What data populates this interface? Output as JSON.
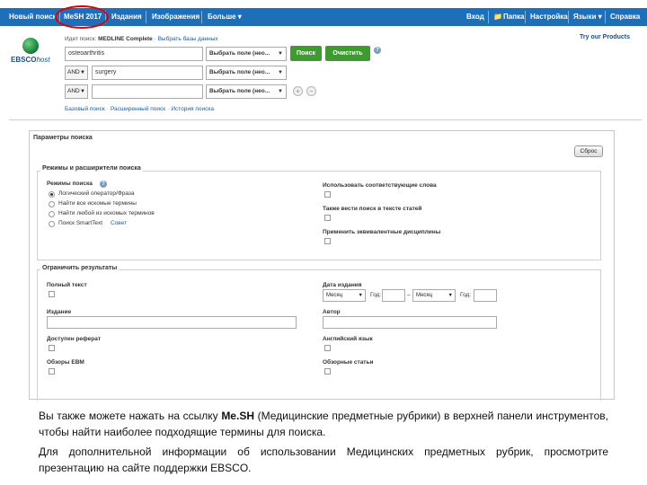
{
  "nav": {
    "left": [
      "Новый поиск",
      "MeSH 2017",
      "Издания",
      "Изображения",
      "Больше ▾"
    ],
    "right": [
      "Вход",
      "Папка",
      "Настройка",
      "Языки ▾",
      "Справка"
    ]
  },
  "try_products": "Try our Products",
  "logo": {
    "brand": "EBSCO",
    "suffix": "host"
  },
  "db_line": {
    "prefix": "Идет поиск:",
    "db": "MEDLINE Complete",
    "choose": "Выбрать базы данных"
  },
  "rows": [
    {
      "bool": "",
      "term": "osteoarthritis",
      "field": "Выбрать поле (нео..."
    },
    {
      "bool": "AND",
      "term": "surgery",
      "field": "Выбрать поле (нео..."
    },
    {
      "bool": "AND",
      "term": "",
      "field": "Выбрать поле (нео..."
    }
  ],
  "buttons": {
    "search": "Поиск",
    "clear": "Очистить",
    "help": "?",
    "add": "+",
    "remove": "−"
  },
  "links": [
    "Базовый поиск",
    "Расширенный поиск",
    "История поиска"
  ],
  "options_panel": {
    "title": "Параметры поиска",
    "close": "Сброс",
    "modes_section": {
      "title": "Режимы и расширители поиска",
      "modes_label": "Режимы поиска",
      "modes": [
        "Логический оператор/Фраза",
        "Найти все искомые термины",
        "Найти любой из искомых терминов",
        "Поиск SmartText"
      ],
      "hint_link": "Совет",
      "right": [
        "Использовать соответствующие слова",
        "Также вести поиск в тексте статей",
        "Применить эквивалентные дисциплины"
      ]
    },
    "limits_section": {
      "title": "Ограничить результаты",
      "full_text": "Полный текст",
      "publication": "Издание",
      "abstract": "Доступен реферат",
      "ebm": "Обзоры EBM",
      "pub_date": "Дата издания",
      "month": "Месяц",
      "year": "Год:",
      "dash": "–",
      "author": "Автор",
      "english": "Английский язык",
      "review": "Обзорные статьи"
    }
  },
  "caption": {
    "p1_before": "Вы также можете нажать на ссылку ",
    "p1_bold": "Me.SH",
    "p1_after": " (Медицинские предметные рубрики) в верхней панели инструментов, чтобы найти наиболее подходящие термины для поиска.",
    "p2": "Для дополнительной информации об использовании Медицинских предметных рубрик, просмотрите презентацию на сайте поддержки EBSCO."
  },
  "colors": {
    "topbar": "#1f6fb8",
    "highlight_circle": "#e00000",
    "button_green": "#3e9b2e"
  }
}
